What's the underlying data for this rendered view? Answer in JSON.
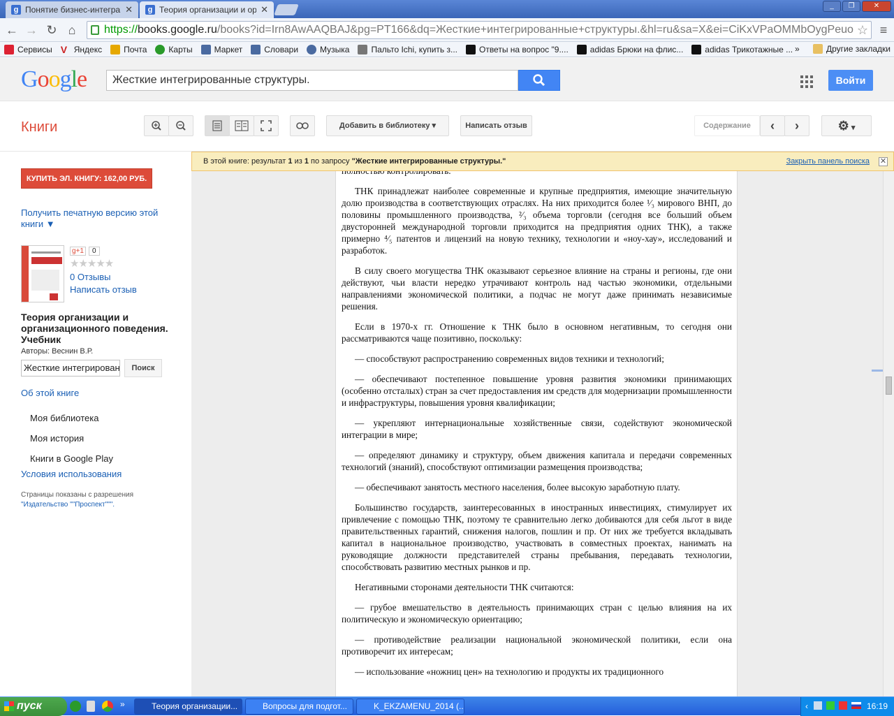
{
  "browser": {
    "tabs": [
      {
        "title": "Понятие бизнес-интеграци",
        "favicon": "g"
      },
      {
        "title": "Теория организации и орга",
        "favicon": "g"
      }
    ],
    "url": {
      "scheme": "https://",
      "host": "books.google.ru",
      "path": "/books?id=Irn8AwAAQBAJ&pg=PT166&dq=Жесткие+интегрированные+структуры.&hl=ru&sa=X&ei=CiKxVPaOMMbOygPeuo"
    },
    "bookmarks": [
      {
        "label": "Сервисы",
        "color": "#d23"
      },
      {
        "label": "Яндекс",
        "color": "#c22"
      },
      {
        "label": "Почта",
        "color": "#e6a800"
      },
      {
        "label": "Карты",
        "color": "#2a9a2a"
      },
      {
        "label": "Маркет",
        "color": "#4a6aa0"
      },
      {
        "label": "Словари",
        "color": "#4a6aa0"
      },
      {
        "label": "Музыка",
        "color": "#4a6aa0"
      },
      {
        "label": "Пальто Ichi, купить з...",
        "color": "#555"
      },
      {
        "label": "Ответы на вопрос \"9....",
        "color": "#111"
      },
      {
        "label": "adidas Брюки на флис...",
        "color": "#111"
      },
      {
        "label": "adidas Трикотажные ...",
        "color": "#111"
      }
    ],
    "bookmarks_more": "»",
    "other_bookmarks": "Другие закладки"
  },
  "google": {
    "logo": "Google",
    "search_value": "Жесткие интегрированные структуры.",
    "login": "Войти"
  },
  "books": {
    "logo": "Книги",
    "add_library": "Добавить в библиотеку",
    "write_review": "Написать отзыв",
    "contents": "Содержание"
  },
  "sidebar": {
    "buy": "КУПИТЬ ЭЛ. КНИГУ: 162,00 РУБ.",
    "print_version": "Получить печатную версию этой книги ▼",
    "gplus": "g+1",
    "gplus_count": "0",
    "stars": "★★★★★",
    "reviews": "0 Отзывы",
    "write_review": "Написать отзыв",
    "title": "Теория организации и организационного поведения. Учебник",
    "authors": "Авторы: Веснин В.Р.",
    "search_value": "Жесткие интегрированн",
    "search_btn": "Поиск",
    "about": "Об этой книге",
    "links": [
      "Моя библиотека",
      "Моя история",
      "Книги в Google Play"
    ],
    "terms": "Условия использования",
    "permission": "Страницы показаны с разрешения",
    "publisher": "\"Издательство \"\"Проспект\"\"\"."
  },
  "notice": {
    "prefix": "В этой книге: результат",
    "n1": "1",
    "of": "из",
    "n2": "1",
    "query_prefix": "по запросу",
    "query": "\"Жесткие интегрированные структуры.\"",
    "close": "Закрыть панель поиска"
  },
  "text": {
    "p0": "используют в качестве инструмента внешней политики, хотя и правительство не может их полностью контролировать.",
    "p1": "ТНК принадлежат наиболее современные и крупные предприятия, имеющие значительную долю производства в соответствующих отраслях. На них приходится более ¹⁄₃ мирового ВНП, до половины промышленного производства, ²⁄₃ объема торговли (сегодня все больший объем двусторонней международной торговли приходится на предприятия одних ТНК), а также примерно ⁴⁄₅ патентов и лицензий на новую технику, технологии и «ноу-хау», исследований и разработок.",
    "p2": "В силу своего могущества ТНК оказывают серьезное влияние на страны и регионы, где они действуют, чьи власти нередко утрачивают контроль над частью экономики, отдельными направлениями экономической политики, а подчас не могут даже принимать независимые решения.",
    "p3": "Если в 1970-х гг. Отношение к ТНК было в основном негативным, то сегодня они рассматриваются чаще позитивно, поскольку:",
    "p4": "— способствуют распространению современных видов техники и технологий;",
    "p5": "— обеспечивают постепенное повышение уровня развития экономики принимающих (особенно отсталых) стран за счет предоставления им средств для модернизации промышленности и инфраструктуры, повышения уровня квалификации;",
    "p6": "— укрепляют интернациональные хозяйственные связи, содействуют экономической интеграции в мире;",
    "p7": "— определяют динамику и структуру, объем движения капитала и передачи современных технологий (знаний), способствуют оптимизации размещения производства;",
    "p8": "— обеспечивают занятость местного населения, более высокую заработную плату.",
    "p9": "Большинство государств, заинтересованных в иностранных инвестициях, стимулирует их привлечение с помощью ТНК, поэтому те сравнительно легко добиваются для себя льгот в виде правительственных гарантий, снижения налогов, пошлин и пр. От них же требуется вкладывать капитал в национальное производство, участвовать в совместных проектах, нанимать на руководящие должности представителей страны пребывания, передавать технологии, способствовать развитию местных рынков и пр.",
    "p10": "Негативными сторонами деятельности ТНК считаются:",
    "p11": "— грубое вмешательство в деятельность принимающих стран с целью влияния на их политическую и экономическую ориентацию;",
    "p12": "— противодействие реализации национальной экономической политики, если она противоречит их интересам;",
    "p13": "— использование «ножниц цен» на технологию и продукты их традиционного"
  },
  "taskbar": {
    "start": "пуск",
    "tasks": [
      "Теория организации...",
      "Вопросы для подгот...",
      "K_EKZAMENU_2014 (..."
    ],
    "clock": "16:19"
  }
}
